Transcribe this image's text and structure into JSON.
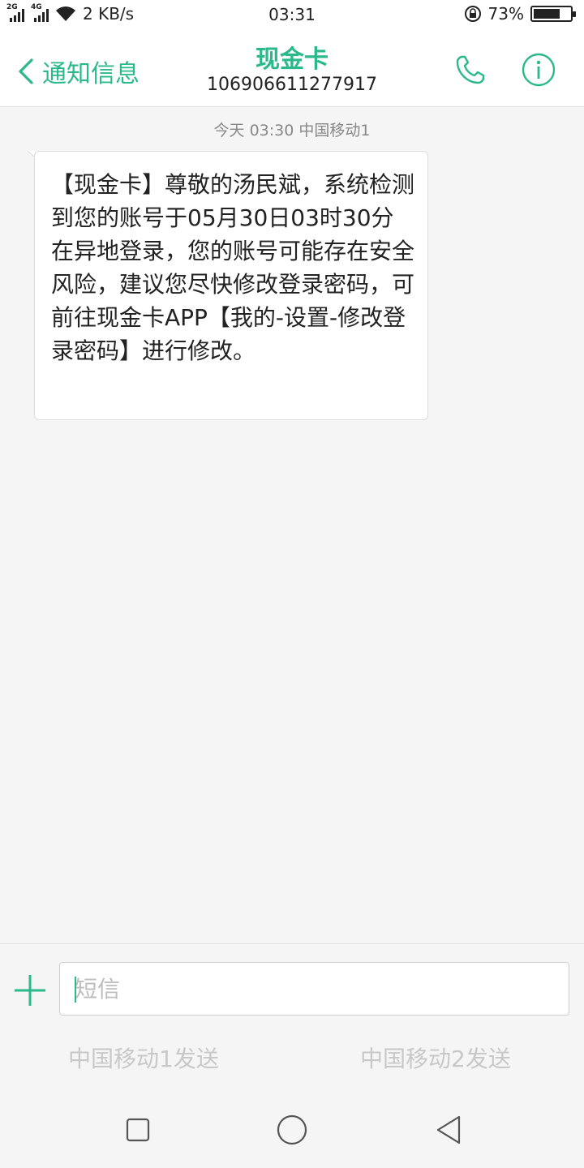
{
  "status_bar": {
    "sim1_network": "2G",
    "sim2_network": "4G",
    "net_speed": "2 KB/s",
    "time": "03:31",
    "battery_percent": "73%",
    "battery_level": 0.73
  },
  "header": {
    "back_label": "通知信息",
    "title": "现金卡",
    "phone_number": "106906611277917",
    "call_icon": "phone-icon",
    "info_icon": "info-icon"
  },
  "conversation": {
    "timestamp": "今天 03:30  中国移动1",
    "messages": [
      {
        "direction": "incoming",
        "text": "【现金卡】尊敬的汤民斌，系统检测到您的账号于05月30日03时30分在异地登录，您的账号可能存在安全风险，建议您尽快修改登录密码，可前往现金卡APP【我的-设置-修改登录密码】进行修改。"
      }
    ]
  },
  "composer": {
    "placeholder": "短信",
    "value": "",
    "send_sim1_label": "中国移动1发送",
    "send_sim2_label": "中国移动2发送"
  },
  "colors": {
    "accent": "#2bb98b",
    "background": "#f5f5f5",
    "bubble": "#ffffff",
    "muted_text": "#888888",
    "disabled_text": "#c8c8c8"
  }
}
